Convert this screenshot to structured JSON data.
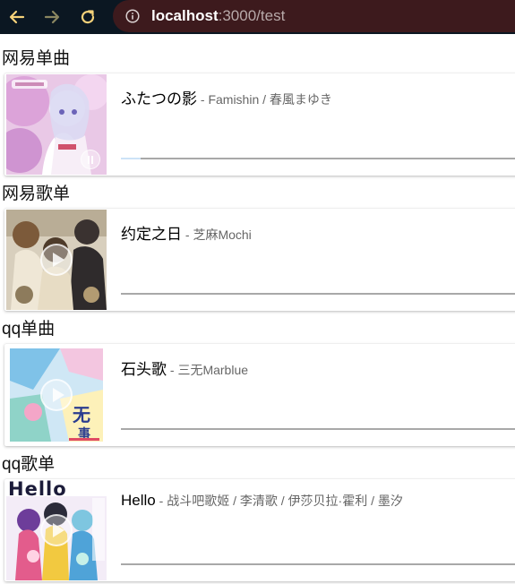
{
  "browser": {
    "url_host": "localhost",
    "url_path": ":3000/test"
  },
  "sections": [
    {
      "title": "网易单曲",
      "song": {
        "title": "ふたつの影",
        "author": " - Famishin / 春風まゆき"
      },
      "state": "playing",
      "loaded": 0.05
    },
    {
      "title": "网易歌单",
      "song": {
        "title": "约定之日",
        "author": " - 芝麻Mochi"
      },
      "state": "paused",
      "loaded": 0
    },
    {
      "title": "qq单曲",
      "song": {
        "title": "石头歌",
        "author": " - 三无Marblue"
      },
      "state": "paused",
      "loaded": 0
    },
    {
      "title": "qq歌单",
      "song": {
        "title": "Hello",
        "author": " - 战斗吧歌姬 / 李清歌 / 伊莎贝拉·霍利 / 墨汐"
      },
      "state": "paused",
      "loaded": 0
    }
  ],
  "icons": {
    "back": "arrow-left-icon",
    "forward": "arrow-right-icon",
    "reload": "reload-icon",
    "info": "info-circle-icon",
    "play": "play-icon",
    "pause": "pause-icon"
  },
  "colors": {
    "toolbar_bg": "#0b1722",
    "urlbar_bg": "#3d1a1d",
    "nav_icon": "#f5d27a",
    "progress_track": "#a8a8a8",
    "progress_loaded": "#cde3f7"
  }
}
